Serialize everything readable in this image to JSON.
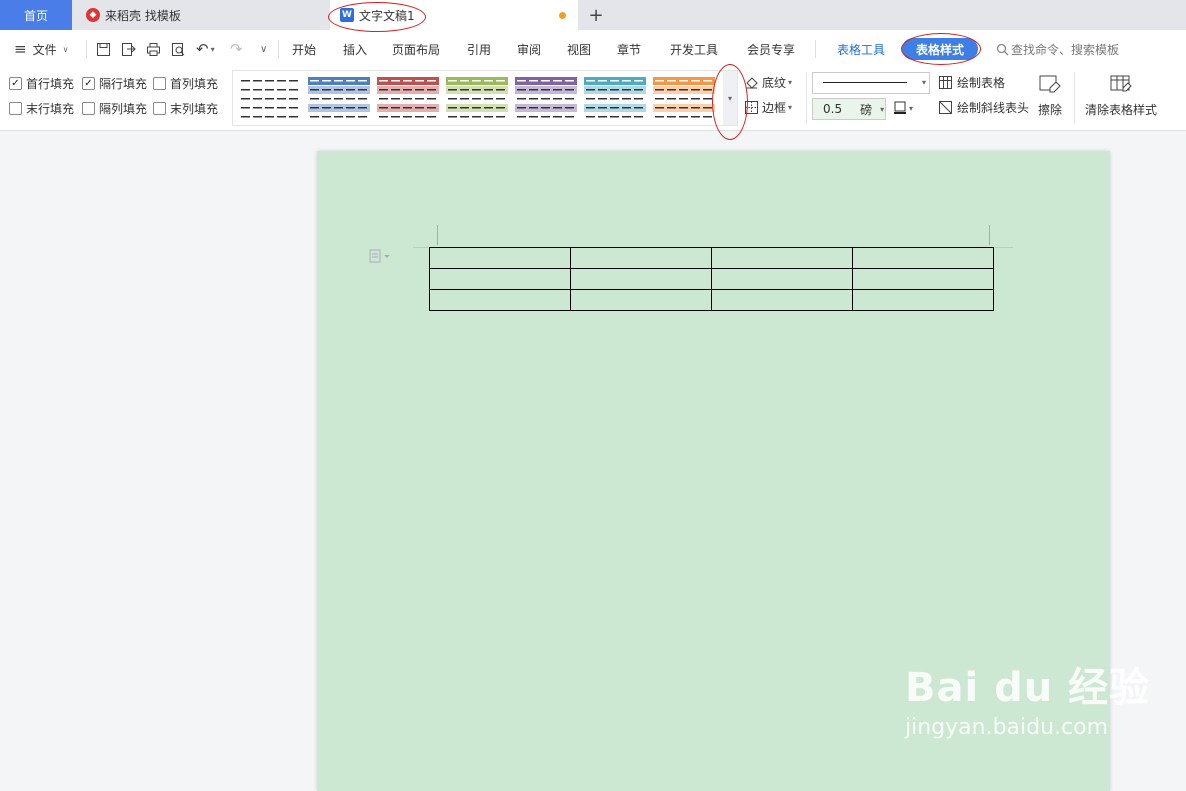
{
  "tabs": {
    "home": "首页",
    "docer": "来稻壳 找模板",
    "doc": "文字文稿1",
    "add": "+"
  },
  "menu": {
    "hamburger": "≡",
    "file": "文件",
    "items": [
      "开始",
      "插入",
      "页面布局",
      "引用",
      "审阅",
      "视图",
      "章节",
      "开发工具",
      "会员专享"
    ],
    "table_tools": "表格工具",
    "table_style": "表格样式",
    "search": "查找命令、搜索模板"
  },
  "ribbon": {
    "options": [
      {
        "label": "首行填充",
        "checked": true
      },
      {
        "label": "隔行填充",
        "checked": true
      },
      {
        "label": "首列填充",
        "checked": false
      },
      {
        "label": "末行填充",
        "checked": false
      },
      {
        "label": "隔列填充",
        "checked": false
      },
      {
        "label": "末列填充",
        "checked": false
      }
    ],
    "style_colors": [
      "#ffffff",
      "#4e7fc1",
      "#c0504d",
      "#9bbb59",
      "#8064a2",
      "#4bacc6",
      "#f79646"
    ],
    "shading": "底纹",
    "border": "边框",
    "line_width": "0.5",
    "line_unit": "磅",
    "draw_table": "绘制表格",
    "draw_diagonal": "绘制斜线表头",
    "erase": "擦除",
    "clear_style": "清除表格样式"
  },
  "document": {
    "table_rows": 3,
    "table_cols": 4
  },
  "watermark": {
    "brand": "Bai du 经验",
    "url": "jingyan.baidu.com"
  },
  "colors": {
    "accent": "#3d7fe6",
    "page": "#cde8d2",
    "annotation": "#d42020"
  }
}
